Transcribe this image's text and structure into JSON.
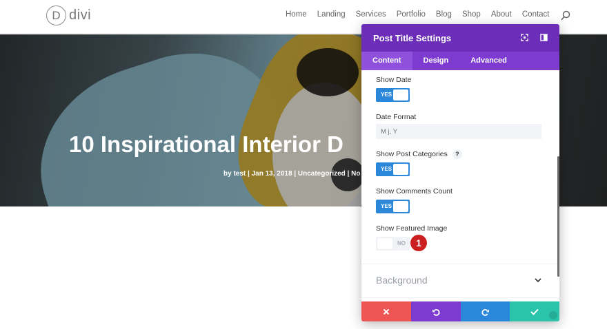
{
  "site": {
    "logo_letter": "D",
    "logo_text": "divi",
    "nav": [
      "Home",
      "Landing",
      "Services",
      "Portfolio",
      "Blog",
      "Shop",
      "About",
      "Contact"
    ]
  },
  "hero": {
    "title": "10 Inspirational Interior D",
    "meta": "by test | Jan 13, 2018 | Uncategorized | No C"
  },
  "modal": {
    "title": "Post Title Settings",
    "tabs": [
      "Content",
      "Design",
      "Advanced"
    ],
    "active_tab": "Content",
    "fields": {
      "show_date": {
        "label": "Show Date",
        "state": "YES"
      },
      "date_format": {
        "label": "Date Format",
        "placeholder": "M j, Y"
      },
      "show_categories": {
        "label": "Show Post Categories",
        "help": "?",
        "state": "YES"
      },
      "show_comments": {
        "label": "Show Comments Count",
        "state": "YES"
      },
      "show_featured": {
        "label": "Show Featured Image",
        "state": "NO"
      }
    },
    "marker": "1",
    "background_group": "Background"
  },
  "colors": {
    "header_purple": "#6c2eb9",
    "tab_purple": "#7e3bd0",
    "toggle_blue": "#2b87da",
    "cancel_red": "#ef5555",
    "save_teal": "#29c4a9",
    "marker_red": "#cc1f1f"
  },
  "icons": {
    "search": "search-icon",
    "expand": "expand-icon",
    "sidebar": "sidebar-toggle-icon",
    "chevron": "chevron-down-icon",
    "cancel": "close-icon",
    "undo": "undo-icon",
    "redo": "redo-icon",
    "save": "check-icon"
  }
}
